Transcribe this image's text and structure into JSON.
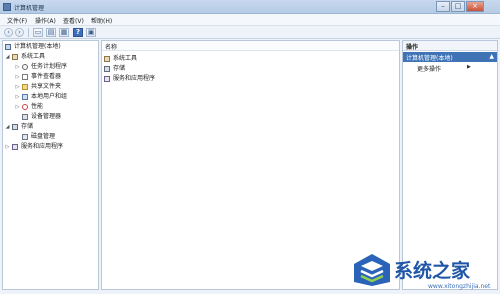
{
  "window": {
    "title": "计算机管理"
  },
  "menu": [
    {
      "label": "文件(F)"
    },
    {
      "label": "操作(A)"
    },
    {
      "label": "查看(V)"
    },
    {
      "label": "帮助(H)"
    }
  ],
  "toolbar": {
    "back_icon": "arrow-left-icon",
    "forward_icon": "arrow-right-icon",
    "help_label": "?"
  },
  "tree": {
    "root": "计算机管理(本地)",
    "items": [
      {
        "label": "系统工具",
        "icon": "tools-icon"
      },
      {
        "label": "任务计划程序",
        "icon": "clock-icon"
      },
      {
        "label": "事件查看器",
        "icon": "log-icon"
      },
      {
        "label": "共享文件夹",
        "icon": "folder-icon"
      },
      {
        "label": "本地用户和组",
        "icon": "users-icon"
      },
      {
        "label": "性能",
        "icon": "performance-icon"
      },
      {
        "label": "设备管理器",
        "icon": "device-icon"
      },
      {
        "label": "存储",
        "icon": "storage-icon"
      },
      {
        "label": "磁盘管理",
        "icon": "disk-icon"
      },
      {
        "label": "服务和应用程序",
        "icon": "services-icon"
      }
    ]
  },
  "list": {
    "column": "名称",
    "rows": [
      {
        "label": "系统工具"
      },
      {
        "label": "存储"
      },
      {
        "label": "服务和应用程序"
      }
    ]
  },
  "actions": {
    "header": "操作",
    "selected": "计算机管理(本地)",
    "more": "更多操作"
  },
  "watermark": {
    "text": "系统之家",
    "url": "www.xitongzhijia.net"
  }
}
